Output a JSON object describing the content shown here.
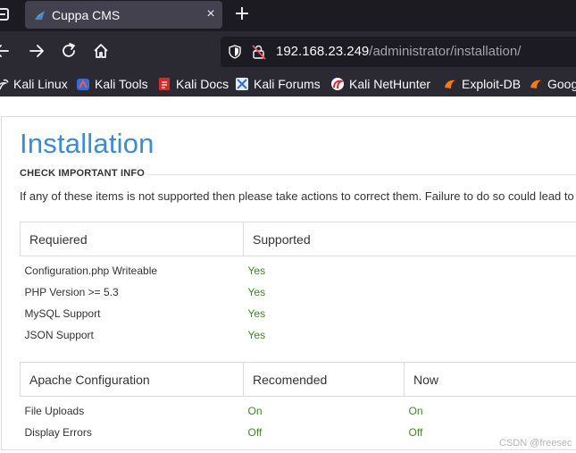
{
  "browser": {
    "tab": {
      "title": "Cuppa CMS",
      "close": "×"
    },
    "new_tab": "+",
    "url": {
      "host": "192.168.23.249",
      "path": "/administrator/installation/"
    },
    "bookmarks": [
      {
        "label": "Kali Linux",
        "icon": "kali-dragon-icon"
      },
      {
        "label": "Kali Tools",
        "icon": "kali-tools-icon"
      },
      {
        "label": "Kali Docs",
        "icon": "kali-docs-icon"
      },
      {
        "label": "Kali Forums",
        "icon": "kali-forums-icon"
      },
      {
        "label": "Kali NetHunter",
        "icon": "nethunter-icon"
      },
      {
        "label": "Exploit-DB",
        "icon": "exploit-db-icon"
      },
      {
        "label": "Google Hacking DB",
        "icon": "ghdb-icon"
      }
    ]
  },
  "page": {
    "title": "Installation",
    "section_title": "CHECK IMPORTANT INFO",
    "info": "If any of these items is not supported then please take actions to correct them. Failure to do so could lead to",
    "requirements": {
      "headers": [
        "Requiered",
        "Supported"
      ],
      "rows": [
        {
          "item": "Configuration.php Writeable",
          "status": "Yes"
        },
        {
          "item": "PHP Version >= 5.3",
          "status": "Yes"
        },
        {
          "item": "MySQL Support",
          "status": "Yes"
        },
        {
          "item": "JSON Support",
          "status": "Yes"
        }
      ]
    },
    "apache": {
      "headers": [
        "Apache Configuration",
        "Recomended",
        "Now"
      ],
      "rows": [
        {
          "item": "File Uploads",
          "recommended": "On",
          "now": "On"
        },
        {
          "item": "Display Errors",
          "recommended": "Off",
          "now": "Off"
        }
      ]
    }
  },
  "watermark": "CSDN @freesec",
  "colors": {
    "title_blue": "#3b8bd6",
    "value_green": "#3d8a1e",
    "chrome_dark": "#1c1b22",
    "chrome_mid": "#2b2a33"
  }
}
